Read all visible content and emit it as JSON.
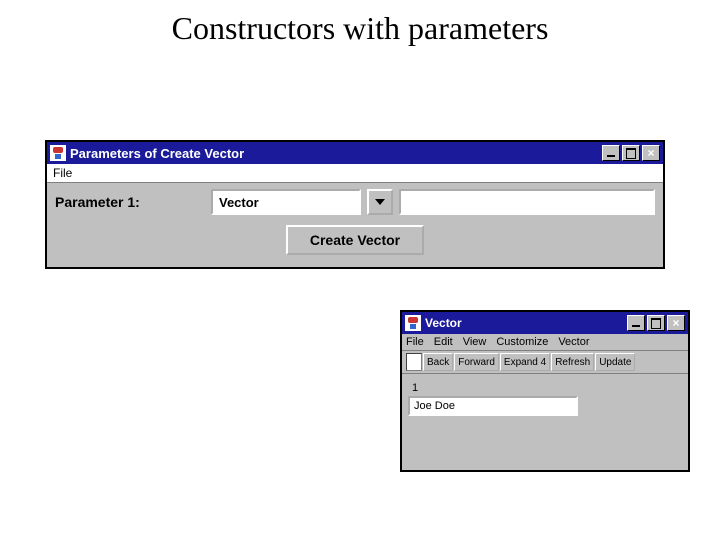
{
  "page": {
    "title": "Constructors with parameters"
  },
  "window1": {
    "title": "Parameters of Create  Vector",
    "menu": {
      "file": "File"
    },
    "param_label": "Parameter 1:",
    "param_value": "Vector",
    "create_button": "Create  Vector",
    "close_glyph": "×"
  },
  "window2": {
    "title": "Vector",
    "menu": {
      "file": "File",
      "edit": "Edit",
      "view": "View",
      "customize": "Customize",
      "vector": "Vector"
    },
    "toolbar": {
      "back": "Back",
      "forward": "Forward",
      "expand": "Expand 4",
      "refresh": "Refresh",
      "update": "Update"
    },
    "count": "1",
    "entry_value": "Joe Doe",
    "close_glyph": "×"
  }
}
